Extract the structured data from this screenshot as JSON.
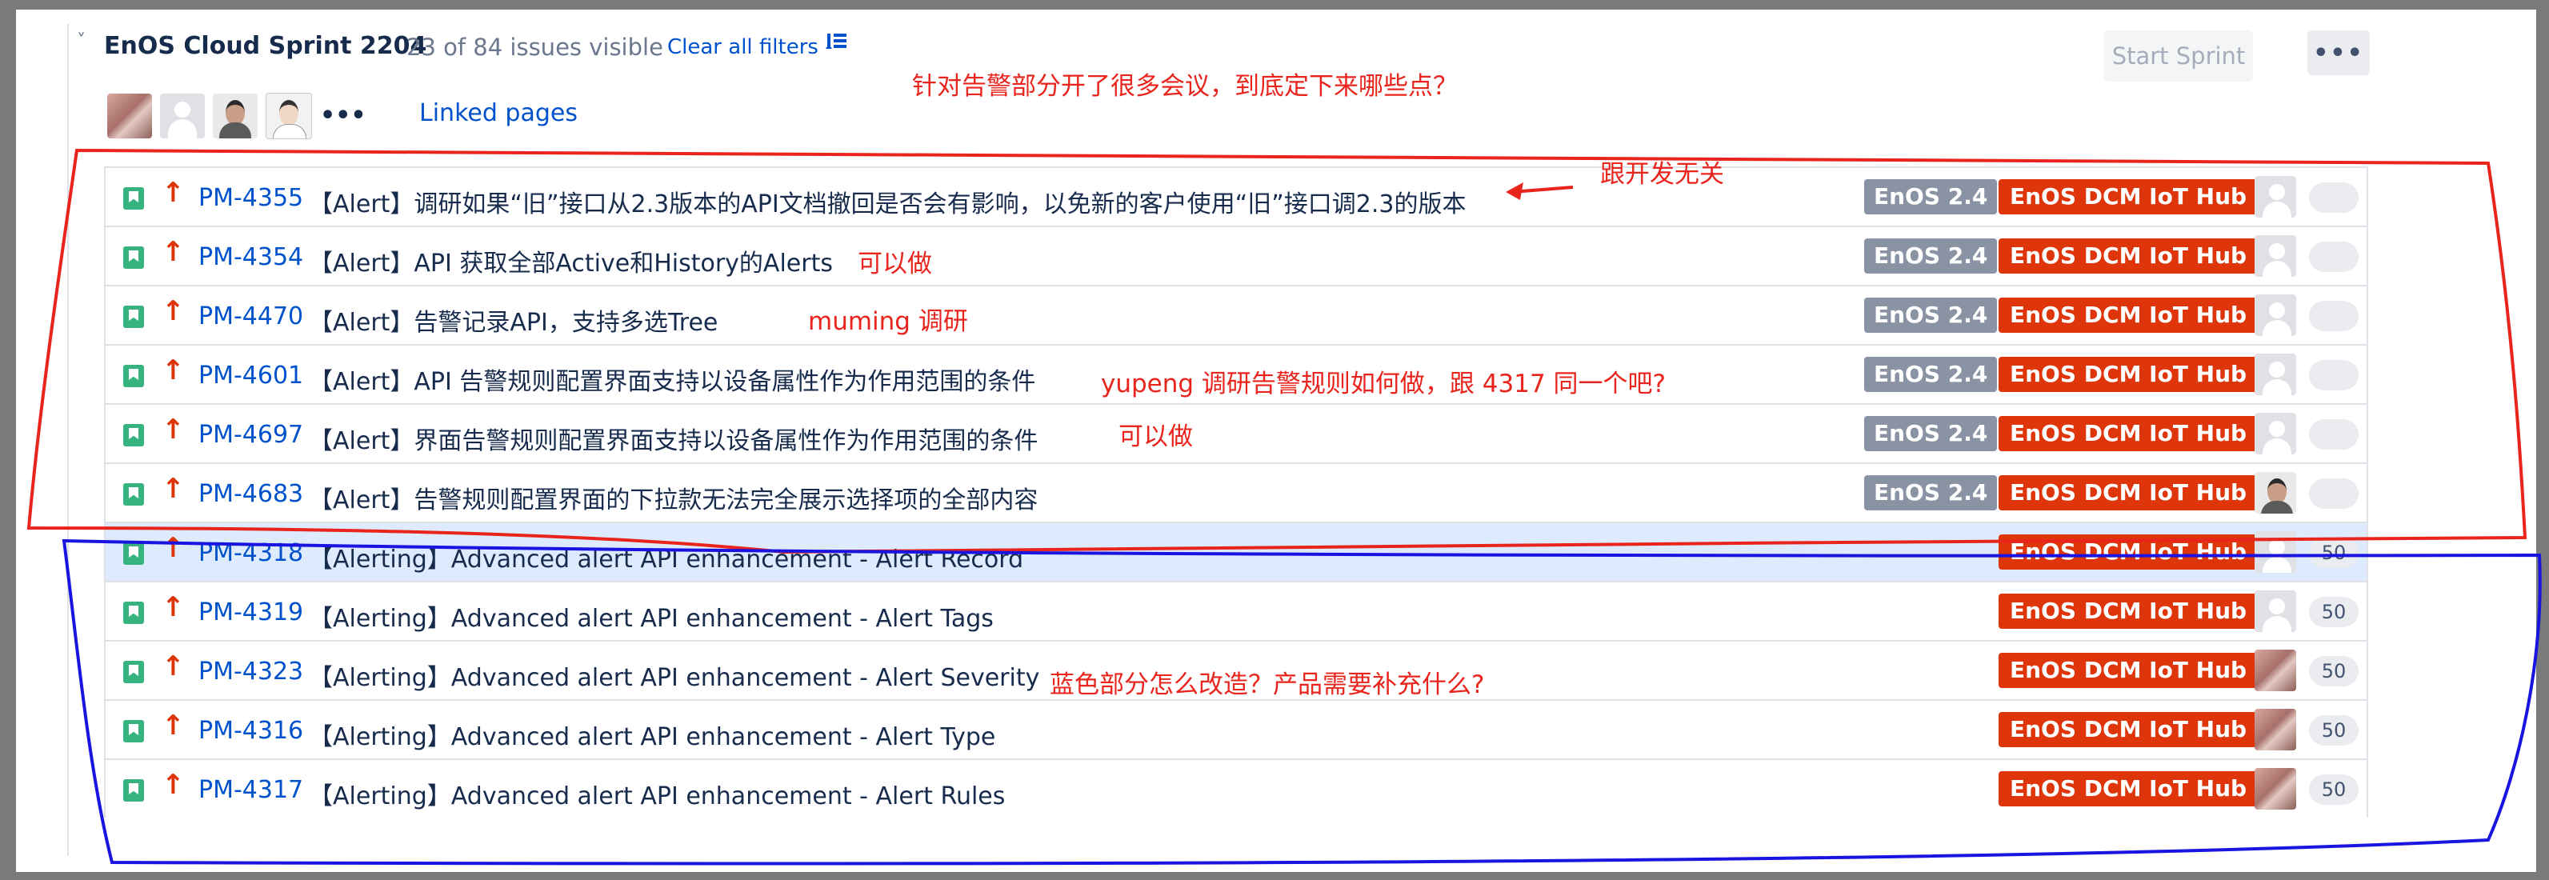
{
  "sprint": {
    "name": "EnOS Cloud Sprint 2204",
    "issue_count": "23 of 84 issues visible",
    "clear_filters": "Clear all filters -",
    "start_sprint": "Start Sprint",
    "more": "•••"
  },
  "toolbar": {
    "avatars_more": "•••",
    "linked_pages": "Linked pages"
  },
  "issues": [
    {
      "key": "PM-4355",
      "summary": "【Alert】调研如果“旧”接口从2.3版本的API文档撤回是否会有影响，以免新的客户使用“旧”接口调2.3的版本",
      "version": "EnOS 2.4",
      "epic": "EnOS DCM IoT Hub",
      "estimate": "",
      "assignee": "blank"
    },
    {
      "key": "PM-4354",
      "summary": "【Alert】API 获取全部Active和History的Alerts",
      "version": "EnOS 2.4",
      "epic": "EnOS DCM IoT Hub",
      "estimate": "",
      "assignee": "blank"
    },
    {
      "key": "PM-4470",
      "summary": "【Alert】告警记录API，支持多选Tree",
      "version": "EnOS 2.4",
      "epic": "EnOS DCM IoT Hub",
      "estimate": "",
      "assignee": "blank"
    },
    {
      "key": "PM-4601",
      "summary": "【Alert】API 告警规则配置界面支持以设备属性作为作用范围的条件",
      "version": "EnOS 2.4",
      "epic": "EnOS DCM IoT Hub",
      "estimate": "",
      "assignee": "blank"
    },
    {
      "key": "PM-4697",
      "summary": "【Alert】界面告警规则配置界面支持以设备属性作为作用范围的条件",
      "version": "EnOS 2.4",
      "epic": "EnOS DCM IoT Hub",
      "estimate": "",
      "assignee": "blank"
    },
    {
      "key": "PM-4683",
      "summary": "【Alert】告警规则配置界面的下拉款无法完全展示选择项的全部内容",
      "version": "EnOS 2.4",
      "epic": "EnOS DCM IoT Hub",
      "estimate": "",
      "assignee": "face"
    },
    {
      "key": "PM-4318",
      "summary": "【Alerting】Advanced alert API enhancement - Alert Record",
      "version": "",
      "epic": "EnOS DCM IoT Hub",
      "estimate": "50",
      "assignee": "blank"
    },
    {
      "key": "PM-4319",
      "summary": "【Alerting】Advanced alert API enhancement - Alert Tags",
      "version": "",
      "epic": "EnOS DCM IoT Hub",
      "estimate": "50",
      "assignee": "blank"
    },
    {
      "key": "PM-4323",
      "summary": "【Alerting】Advanced alert API enhancement - Alert Severity",
      "version": "",
      "epic": "EnOS DCM IoT Hub",
      "estimate": "50",
      "assignee": "photo"
    },
    {
      "key": "PM-4316",
      "summary": "【Alerting】Advanced alert API enhancement - Alert Type",
      "version": "",
      "epic": "EnOS DCM IoT Hub",
      "estimate": "50",
      "assignee": "photo"
    },
    {
      "key": "PM-4317",
      "summary": "【Alerting】Advanced alert API enhancement - Alert Rules",
      "version": "",
      "epic": "EnOS DCM IoT Hub",
      "estimate": "50",
      "assignee": "photo"
    }
  ],
  "annotations": {
    "top_question": "针对告警部分开了很多会议，到底定下来哪些点？",
    "unrelated": "跟开发无关",
    "can_do_1": "可以做",
    "muming": "muming 调研",
    "yupeng": "yupeng 调研告警规则如何做，跟 4317 同一个吧?",
    "can_do_2": "可以做",
    "blue_question": "蓝色部分怎么改造？产品需要补充什么?"
  },
  "colors": {
    "link": "#0052cc",
    "epic": "#de350b",
    "version": "#8993a4",
    "story": "#36b37e",
    "priority": "#de350b",
    "annotation_red": "#e8241d",
    "annotation_blue": "#1a14e0"
  }
}
